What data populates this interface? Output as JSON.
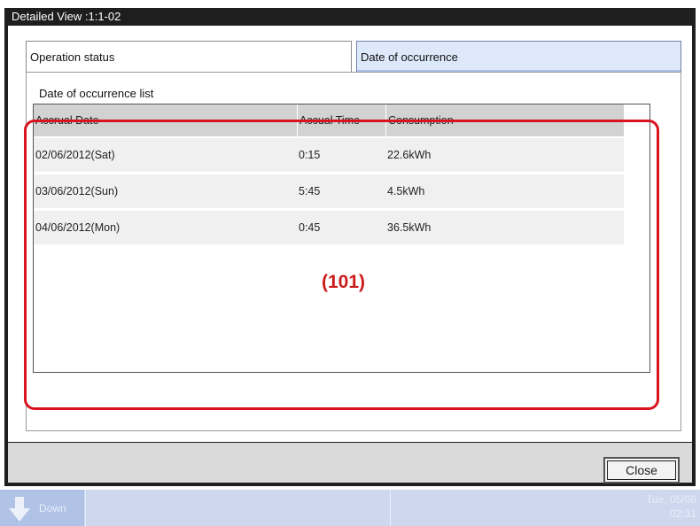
{
  "window": {
    "title": "Detailed View :1:1-02"
  },
  "tabs": [
    {
      "label": "Operation status"
    },
    {
      "label": "Date of occurrence"
    }
  ],
  "panel": {
    "title": "Date of occurrence list"
  },
  "table": {
    "columns": [
      "Accrual Date",
      "Accual Time",
      "Consumption"
    ],
    "rows": [
      [
        "02/06/2012(Sat)",
        "0:15",
        "22.6kWh"
      ],
      [
        "03/06/2012(Sun)",
        "5:45",
        "4.5kWh"
      ],
      [
        "04/06/2012(Mon)",
        "0:45",
        "36.5kWh"
      ]
    ]
  },
  "annotation": {
    "label": "(101)",
    "color": "#d9141e"
  },
  "footer": {
    "close_label": "Close"
  },
  "taskbar": {
    "button_label": "Down",
    "date": "Tue, 05/06",
    "time": "02:31"
  },
  "colors": {
    "selected_tab": "#dde9fb",
    "header_bg": "#d2d2d2",
    "taskbar": "#cdd8ee"
  }
}
